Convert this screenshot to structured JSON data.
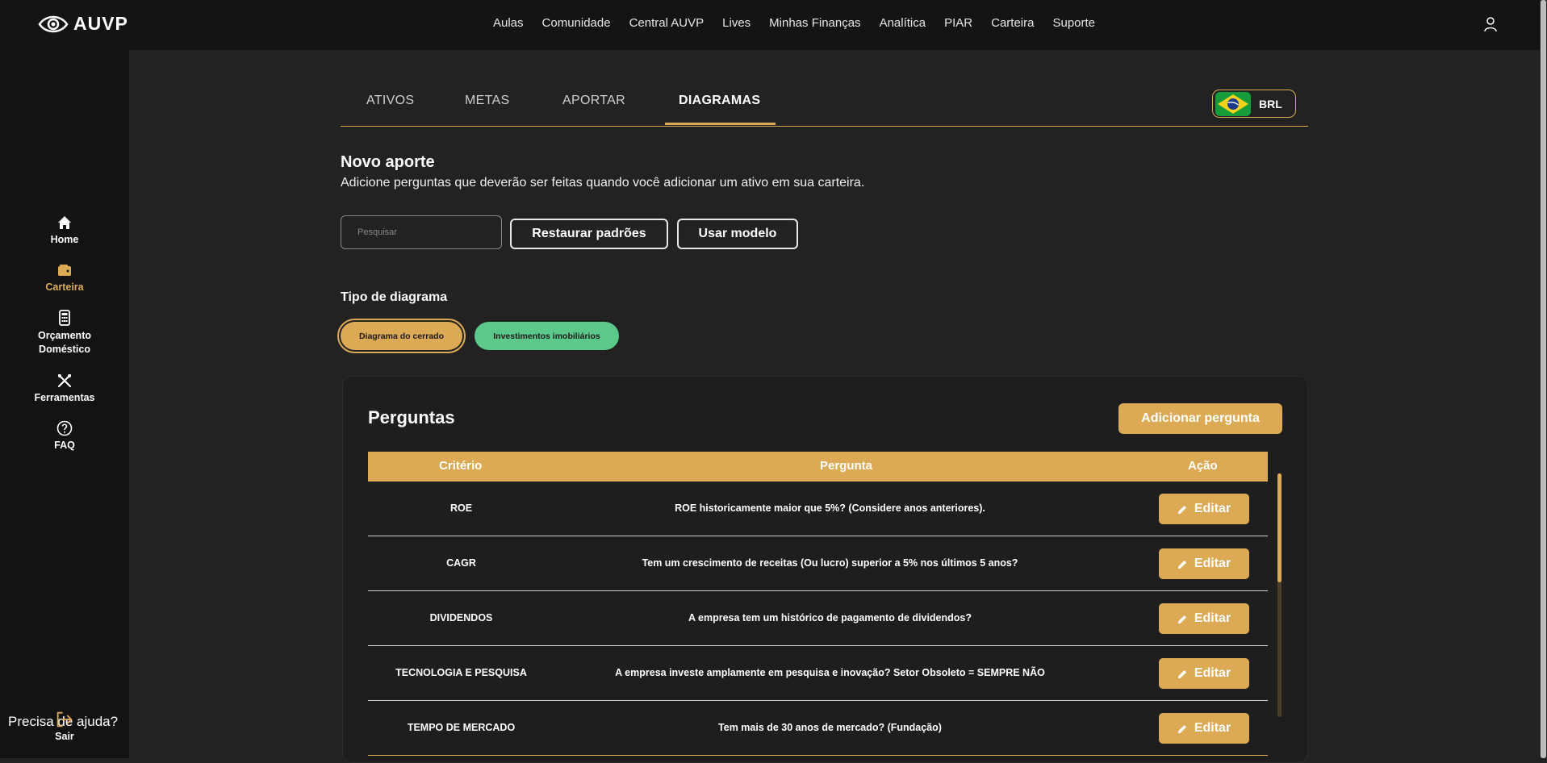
{
  "header": {
    "logo_text": "AUVP",
    "nav": [
      "Aulas",
      "Comunidade",
      "Central AUVP",
      "Lives",
      "Minhas Finanças",
      "Analítica",
      "PIAR",
      "Carteira",
      "Suporte"
    ]
  },
  "sidebar": {
    "items": [
      {
        "label": "Home",
        "icon": "home-icon"
      },
      {
        "label": "Carteira",
        "icon": "wallet-icon",
        "active": true
      },
      {
        "label": "Orçamento Doméstico",
        "line1": "Orçamento",
        "line2": "Doméstico",
        "icon": "calculator-icon"
      },
      {
        "label": "Ferramentas",
        "icon": "tools-icon"
      },
      {
        "label": "FAQ",
        "icon": "help-icon"
      }
    ],
    "help_text": "Precisa de ajuda?",
    "logout_label": "Sair"
  },
  "tabs": [
    "ATIVOS",
    "METAS",
    "APORTAR",
    "DIAGRAMAS"
  ],
  "active_tab": "DIAGRAMAS",
  "currency": {
    "code": "BRL",
    "flag": "brazil-flag-icon"
  },
  "page": {
    "title": "Novo aporte",
    "subtitle": "Adicione perguntas que deverão ser feitas quando você adicionar um ativo em sua carteira."
  },
  "search": {
    "placeholder": "Pesquisar",
    "value": ""
  },
  "buttons": {
    "restore": "Restaurar padrões",
    "use_model": "Usar modelo",
    "add_question": "Adicionar pergunta",
    "edit": "Editar"
  },
  "diagram_type": {
    "title": "Tipo de diagrama",
    "options": [
      "Diagrama do cerrado",
      "Investimentos imobiliários"
    ],
    "selected": "Diagrama do cerrado"
  },
  "questions": {
    "title": "Perguntas",
    "columns": [
      "Critério",
      "Pergunta",
      "Ação"
    ],
    "rows": [
      {
        "criterion": "ROE",
        "question": "ROE historicamente maior que 5%? (Considere anos anteriores)."
      },
      {
        "criterion": "CAGR",
        "question": "Tem um crescimento de receitas (Ou lucro) superior a 5% nos últimos 5 anos?"
      },
      {
        "criterion": "DIVIDENDOS",
        "question": "A empresa tem um histórico de pagamento de dividendos?"
      },
      {
        "criterion": "TECNOLOGIA E PESQUISA",
        "question": "A empresa investe amplamente em pesquisa e inovação? Setor Obsoleto = SEMPRE NÃO"
      },
      {
        "criterion": "TEMPO DE MERCADO",
        "question": "Tem mais de 30 anos de mercado? (Fundação)"
      }
    ]
  },
  "colors": {
    "accent": "#dcaa55",
    "green": "#5cc98a",
    "background": "#222222",
    "topbar": "#141414"
  }
}
